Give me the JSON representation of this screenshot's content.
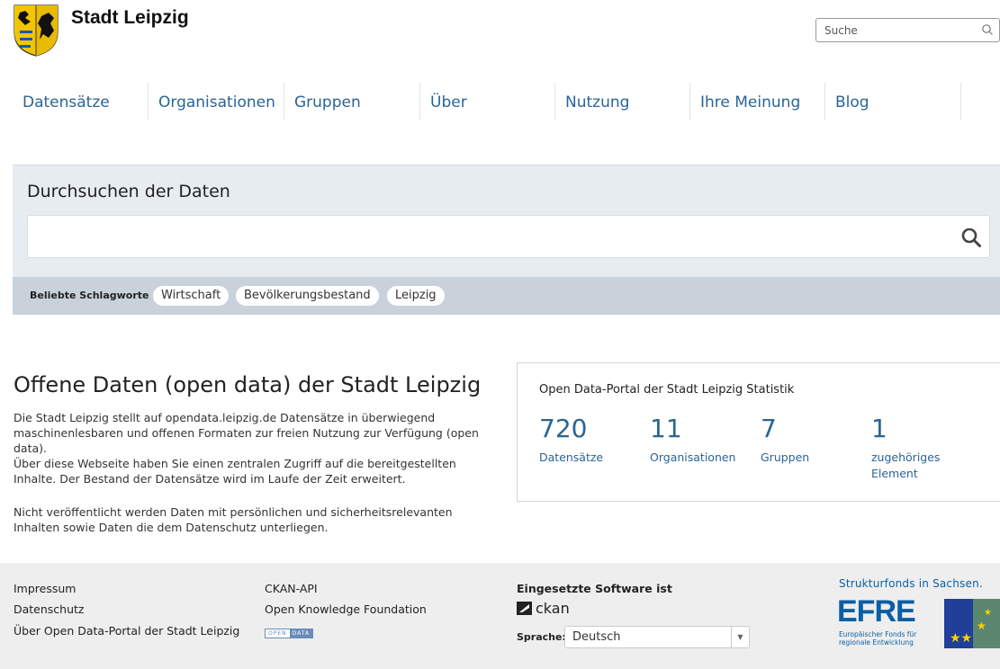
{
  "header": {
    "site_title": "Stadt Leipzig",
    "search_placeholder": "Suche"
  },
  "nav": {
    "items": [
      "Datensätze",
      "Organisationen",
      "Gruppen",
      "Über",
      "Nutzung",
      "Ihre Meinung",
      "Blog"
    ]
  },
  "hero": {
    "title": "Durchsuchen der Daten",
    "search_value": "",
    "tags_label": "Beliebte Schlagworte",
    "tags": [
      "Wirtschaft",
      "Bevölkerungsbestand",
      "Leipzig"
    ]
  },
  "intro": {
    "title": "Offene Daten (open data) der Stadt Leipzig",
    "paragraph1": "Die Stadt Leipzig stellt auf opendata.leipzig.de Datensätze in überwiegend maschinenlesbaren und offenen Formaten zur freien Nutzung zur Verfügung (open data).",
    "paragraph2": "Über diese Webseite haben Sie einen zentralen Zugriff auf die bereitgestellten Inhalte. Der Bestand der Datensätze wird im Laufe der Zeit erweitert.",
    "paragraph3": "Nicht veröffentlicht werden Daten mit persönlichen und sicherheitsrelevanten Inhalten sowie Daten die dem Datenschutz unterliegen."
  },
  "stats": {
    "title": "Open Data-Portal der Stadt Leipzig Statistik",
    "items": [
      {
        "number": "720",
        "label": "Datensätze"
      },
      {
        "number": "11",
        "label": "Organisationen"
      },
      {
        "number": "7",
        "label": "Gruppen"
      },
      {
        "number": "1",
        "label": "zugehöriges Element"
      }
    ]
  },
  "footer": {
    "links_col1": [
      "Impressum",
      "Datenschutz",
      "Über Open Data-Portal der Stadt Leipzig"
    ],
    "links_col2": [
      "CKAN-API",
      "Open Knowledge Foundation"
    ],
    "open_data_badge": [
      "OPEN",
      "DATA"
    ],
    "software_label": "Eingesetzte Software ist",
    "software_name": "ckan",
    "language_label": "Sprache:",
    "language_value": "Deutsch",
    "efre_top": "Strukturfonds in Sachsen.",
    "efre_word": "EFRE",
    "efre_sub": "Europäischer Fonds für regionale Entwicklung"
  },
  "colors": {
    "link_blue": "#2a6496",
    "hero_bg": "#e7ecf1",
    "tagbar_bg": "#c9d2db",
    "footer_bg": "#eeeeee",
    "efre_blue": "#0a5fa6"
  }
}
